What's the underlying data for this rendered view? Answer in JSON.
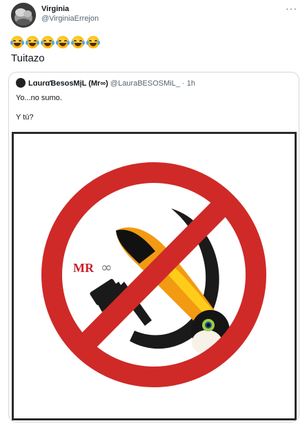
{
  "tweet": {
    "author_name": "Virginia",
    "author_handle": "@VirginiaErrejon",
    "emoji_icon": "face-with-tears-of-joy-icon",
    "emoji_count": 6,
    "text": "Tuitazo"
  },
  "quoted_tweet": {
    "author_name": "LɑuɾɑƁesosMįL (Mr∞)",
    "author_handle": "@LauraBESOSMiL_",
    "time": "· 1h",
    "line1": "Yo...no sumo.",
    "line2": "Y tú?",
    "image": {
      "logo_text": "MR",
      "logo_symbol": "∞",
      "colors": {
        "prohibition_red": "#cf2a27",
        "hammer_sickle": "#1a1a1a",
        "toucan_beak": "#f29a12",
        "logo_red": "#c8202a"
      }
    }
  }
}
